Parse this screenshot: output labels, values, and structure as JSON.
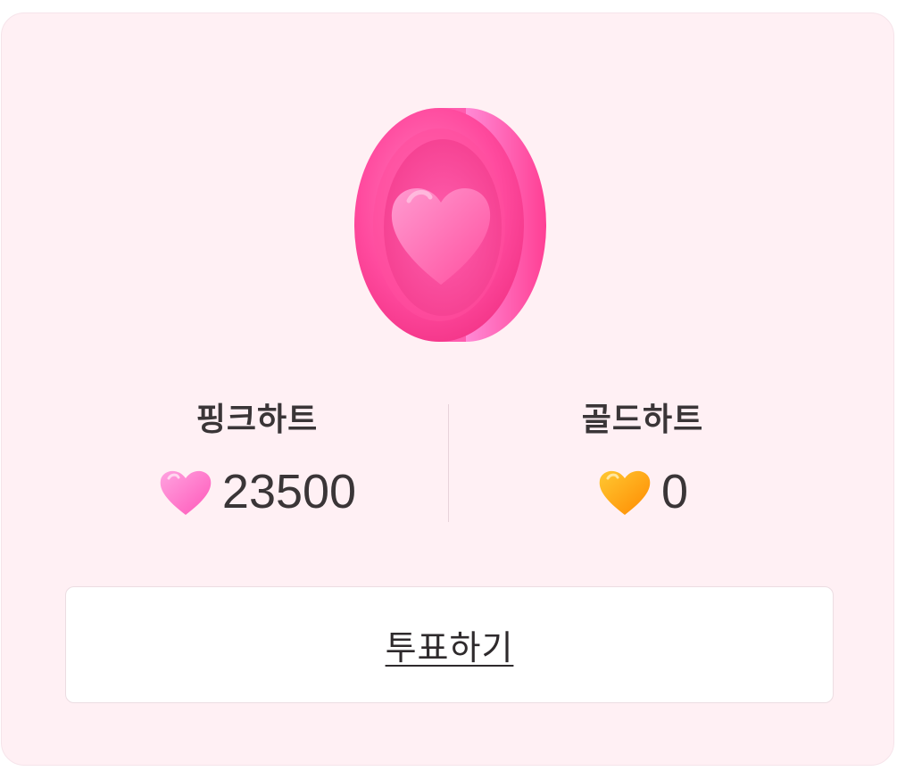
{
  "coin": {
    "icon": "heart-coin-icon",
    "color": "#ff3f94"
  },
  "pink_heart": {
    "title": "핑크하트",
    "value": "23500",
    "icon": "pink-heart-icon",
    "color": "#ff6bc8"
  },
  "gold_heart": {
    "title": "골드하트",
    "value": "0",
    "icon": "gold-heart-icon",
    "color": "#ff9a00"
  },
  "vote_button": {
    "label": "투표하기"
  },
  "colors": {
    "card_background": "#fff0f4",
    "text": "#3a3537",
    "button_background": "#ffffff"
  }
}
